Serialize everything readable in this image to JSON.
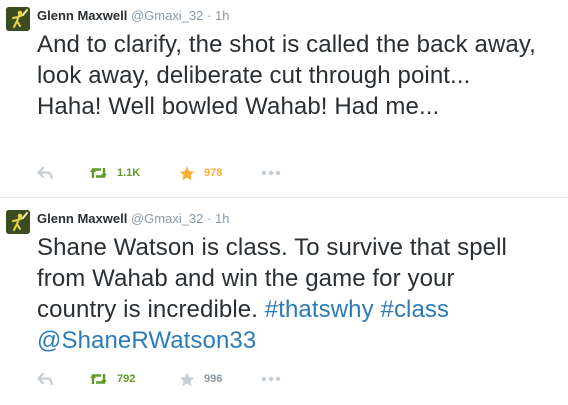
{
  "tweets": [
    {
      "author": {
        "name": "Glenn Maxwell",
        "handle": "@Gmaxi_32",
        "time": "1h"
      },
      "text": "And to clarify, the shot is called the back away, look away, deliberate cut through point... Haha! Well bowled Wahab! Had me...",
      "actions": {
        "retweet_count": "1.1K",
        "favorite_count": "978",
        "retweet_active": true,
        "favorite_active": true
      }
    },
    {
      "author": {
        "name": "Glenn Maxwell",
        "handle": "@Gmaxi_32",
        "time": "1h"
      },
      "text_plain": "Shane Watson is class. To survive that spell from Wahab and win the game for your country is incredible.",
      "hashtags": [
        "#thatswhy",
        "#class"
      ],
      "mention": "@ShaneRWatson33",
      "actions": {
        "retweet_count": "792",
        "favorite_count": "996",
        "retweet_active": true,
        "favorite_active": false
      }
    }
  ],
  "separator": "·",
  "colors": {
    "link": "#2b7bb9",
    "retweet_active": "#609928",
    "favorite_active": "#ffac33",
    "muted": "#8899a6",
    "text": "#292f33"
  },
  "icons": {
    "avatar": "cricket-player-avatar",
    "reply": "reply-arrow-icon",
    "retweet": "retweet-icon",
    "favorite": "star-icon",
    "more": "ellipsis-icon"
  }
}
